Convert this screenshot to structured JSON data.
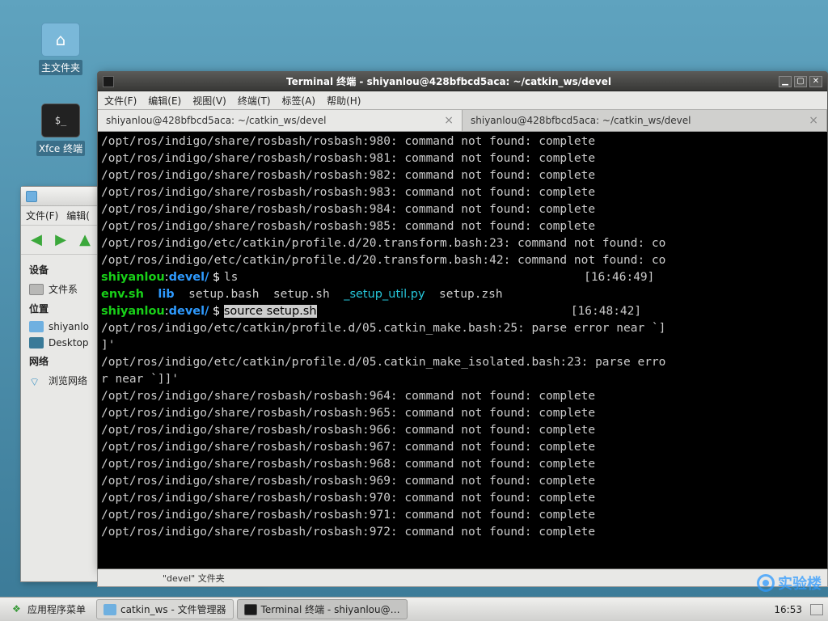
{
  "desktop_icons": {
    "home": {
      "label": "主文件夹",
      "glyph": "⌂"
    },
    "terminal": {
      "label": "Xfce 终端",
      "glyph": "$_"
    }
  },
  "file_manager": {
    "menu": {
      "file": "文件(F)",
      "edit": "编辑("
    },
    "sections": {
      "devices": "设备",
      "device_fs": "文件系",
      "places": "位置",
      "place_home": "shiyanlo",
      "place_desktop": "Desktop",
      "network": "网络",
      "net_browse": "浏览网络"
    }
  },
  "terminal": {
    "title": "Terminal 终端 - shiyanlou@428bfbcd5aca: ~/catkin_ws/devel",
    "menu": {
      "file": "文件(F)",
      "edit": "编辑(E)",
      "view": "视图(V)",
      "terminal": "终端(T)",
      "tabs": "标签(A)",
      "help": "帮助(H)"
    },
    "tabs": [
      {
        "label": "shiyanlou@428bfbcd5aca: ~/catkin_ws/devel"
      },
      {
        "label": "shiyanlou@428bfbcd5aca: ~/catkin_ws/devel"
      }
    ],
    "lines": [
      {
        "t": "plain",
        "txt": "/opt/ros/indigo/share/rosbash/rosbash:980: command not found: complete"
      },
      {
        "t": "plain",
        "txt": "/opt/ros/indigo/share/rosbash/rosbash:981: command not found: complete"
      },
      {
        "t": "plain",
        "txt": "/opt/ros/indigo/share/rosbash/rosbash:982: command not found: complete"
      },
      {
        "t": "plain",
        "txt": "/opt/ros/indigo/share/rosbash/rosbash:983: command not found: complete"
      },
      {
        "t": "plain",
        "txt": "/opt/ros/indigo/share/rosbash/rosbash:984: command not found: complete"
      },
      {
        "t": "plain",
        "txt": "/opt/ros/indigo/share/rosbash/rosbash:985: command not found: complete"
      },
      {
        "t": "plain",
        "txt": "/opt/ros/indigo/etc/catkin/profile.d/20.transform.bash:23: command not found: co"
      },
      {
        "t": "plain",
        "txt": "/opt/ros/indigo/etc/catkin/profile.d/20.transform.bash:42: command not found: co"
      },
      {
        "t": "prompt1",
        "user": "shiyanlou",
        "path": "devel/",
        "cmd": "ls",
        "ts": "[16:46:49]"
      },
      {
        "t": "ls",
        "env": "env.sh",
        "lib": "lib",
        "rest": "  setup.bash  setup.sh  ",
        "util": "_setup_util.py",
        "rest2": "  setup.zsh"
      },
      {
        "t": "prompt2",
        "user": "shiyanlou",
        "path": "devel/",
        "cmd": "source setup.sh",
        "ts": "[16:48:42]"
      },
      {
        "t": "plain",
        "txt": "/opt/ros/indigo/etc/catkin/profile.d/05.catkin_make.bash:25: parse error near `]"
      },
      {
        "t": "plain",
        "txt": "]'"
      },
      {
        "t": "plain",
        "txt": "/opt/ros/indigo/etc/catkin/profile.d/05.catkin_make_isolated.bash:23: parse erro"
      },
      {
        "t": "plain",
        "txt": "r near `]]'"
      },
      {
        "t": "plain",
        "txt": "/opt/ros/indigo/share/rosbash/rosbash:964: command not found: complete"
      },
      {
        "t": "plain",
        "txt": "/opt/ros/indigo/share/rosbash/rosbash:965: command not found: complete"
      },
      {
        "t": "plain",
        "txt": "/opt/ros/indigo/share/rosbash/rosbash:966: command not found: complete"
      },
      {
        "t": "plain",
        "txt": "/opt/ros/indigo/share/rosbash/rosbash:967: command not found: complete"
      },
      {
        "t": "plain",
        "txt": "/opt/ros/indigo/share/rosbash/rosbash:968: command not found: complete"
      },
      {
        "t": "plain",
        "txt": "/opt/ros/indigo/share/rosbash/rosbash:969: command not found: complete"
      },
      {
        "t": "plain",
        "txt": "/opt/ros/indigo/share/rosbash/rosbash:970: command not found: complete"
      },
      {
        "t": "plain",
        "txt": "/opt/ros/indigo/share/rosbash/rosbash:971: command not found: complete"
      },
      {
        "t": "plain",
        "txt": "/opt/ros/indigo/share/rosbash/rosbash:972: command not found: complete"
      }
    ]
  },
  "statusbar": {
    "text": "\"devel\" 文件夹"
  },
  "taskbar": {
    "menu": "应用程序菜单",
    "fm": "catkin_ws - 文件管理器",
    "term": "Terminal 终端 - shiyanlou@…",
    "clock": "16:53"
  },
  "watermark": "实验楼"
}
